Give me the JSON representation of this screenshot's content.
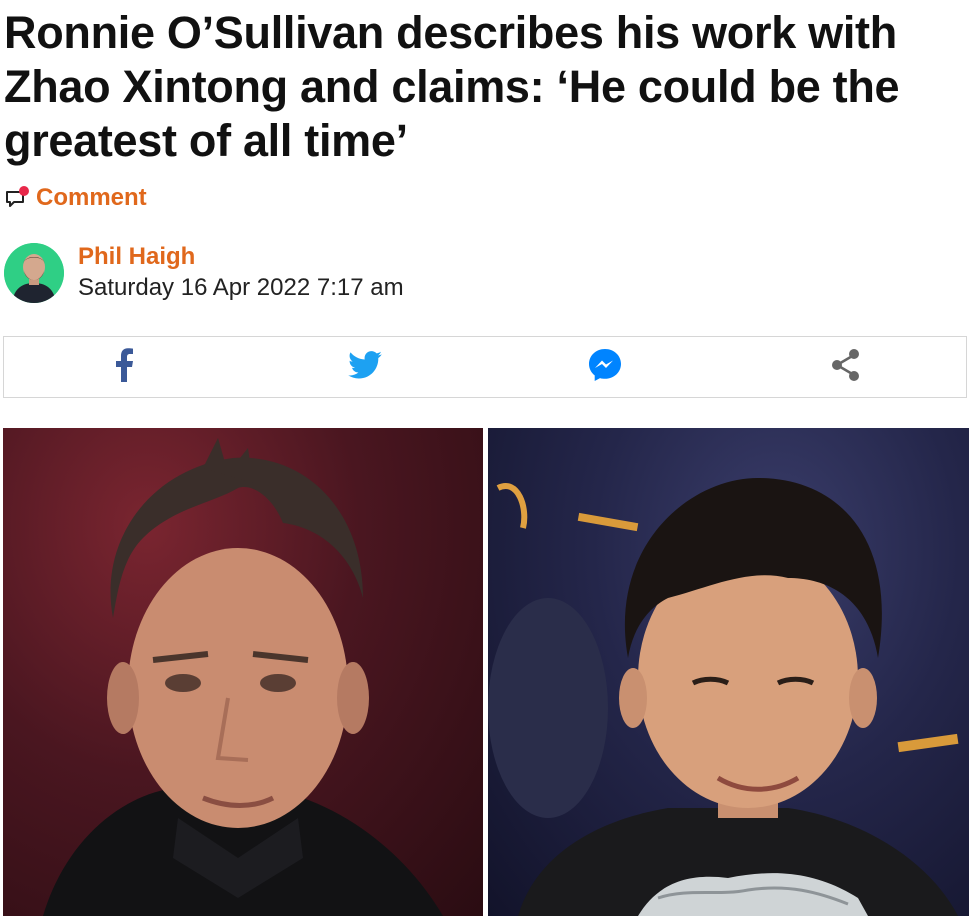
{
  "article": {
    "headline": "Ronnie O’Sullivan describes his work with Zhao Xintong and claims: ‘He could be the greatest of all time’"
  },
  "comment": {
    "label": "Comment",
    "icon": "comment-bubble-icon",
    "accent": "#e0681c",
    "dot_color": "#e8284a"
  },
  "author": {
    "name": "Phil Haigh",
    "date": "Saturday 16 Apr 2022 7:17 am",
    "avatar_bg": "#2fcf85"
  },
  "share": {
    "buttons": [
      {
        "icon": "facebook-icon",
        "color": "#3b5998"
      },
      {
        "icon": "twitter-icon",
        "color": "#1da1f2"
      },
      {
        "icon": "messenger-icon",
        "color": "#0084ff"
      },
      {
        "icon": "share-icon",
        "color": "#666666"
      }
    ]
  },
  "photos": [
    {
      "subject": "ronnie-osullivan-photo"
    },
    {
      "subject": "zhao-xintong-photo"
    }
  ]
}
